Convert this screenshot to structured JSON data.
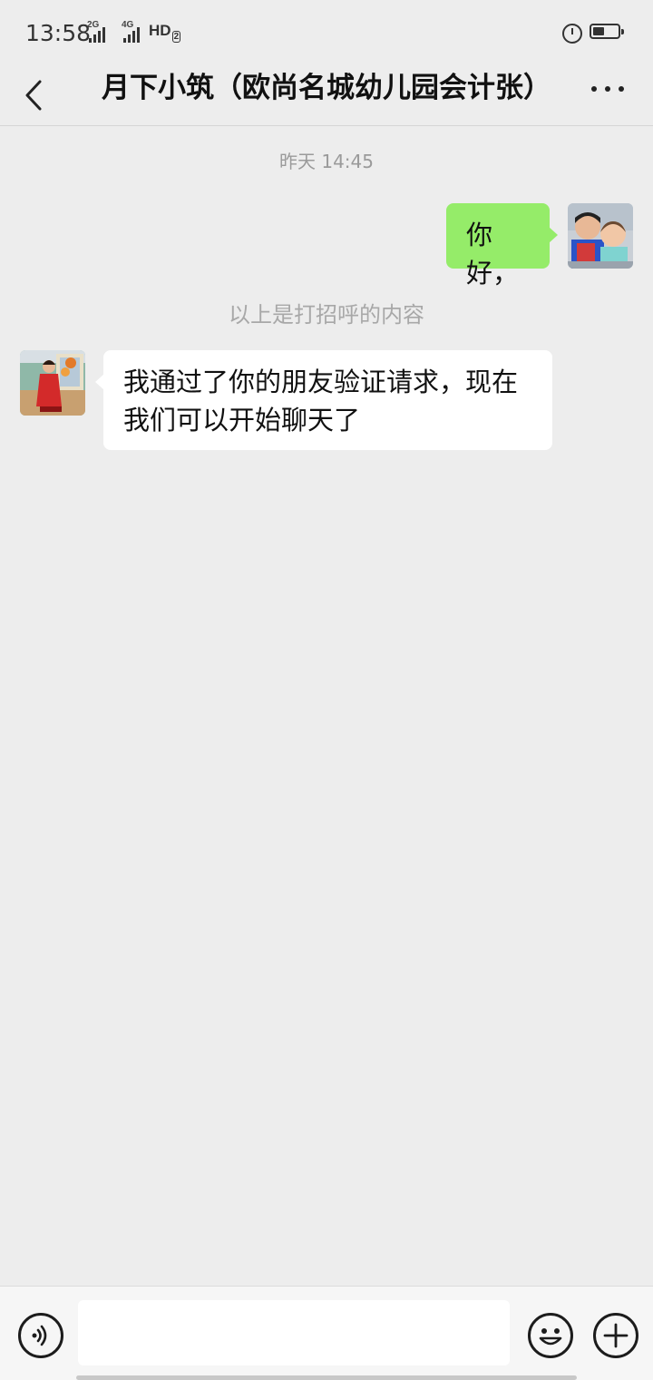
{
  "status_bar": {
    "time": "13:58",
    "signal1_label": "2G",
    "signal2_label": "4G",
    "hd_label": "HD",
    "hd_sub": "2",
    "battery_level": 0.45
  },
  "header": {
    "title": "月下小筑（欧尚名城幼儿园会计张）"
  },
  "chat": {
    "timestamp": "昨天 14:45",
    "outgoing_message": "你好，",
    "system_note": "以上是打招呼的内容",
    "incoming_message": "我通过了你的朋友验证请求，现在我们可以开始聊天了"
  },
  "input_bar": {
    "placeholder": ""
  },
  "icons": {
    "back": "chevron-left-icon",
    "more": "more-horizontal-icon",
    "voice": "voice-icon",
    "emoji": "emoji-icon",
    "plus": "plus-icon"
  },
  "colors": {
    "background": "#ededed",
    "outgoing_bubble": "#95ec69",
    "incoming_bubble": "#ffffff"
  }
}
